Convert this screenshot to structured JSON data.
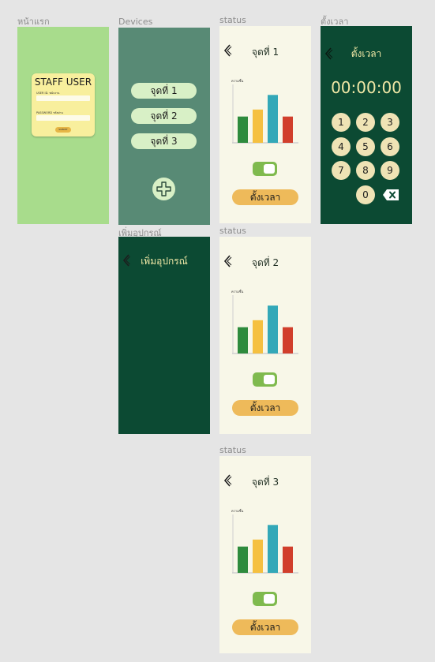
{
  "frame_labels": {
    "login": "หน้าแรก",
    "devices": "Devices",
    "add_device": "เพิ่มอุปกรณ์",
    "timer": "ตั้งเวลา",
    "status": "status"
  },
  "login": {
    "title": "STAFF USER",
    "user_label": "USER ID. พนักงาน",
    "password_label": "PASSWORD รหัสผ่าน",
    "submit_label": "SUBMIT"
  },
  "devices": {
    "items": [
      "จุดที่ 1",
      "จุดที่ 2",
      "จุดที่ 3"
    ],
    "add_icon": "plus-icon"
  },
  "add_device": {
    "title": "เพิ่มอุปกรณ์"
  },
  "status_screens": [
    {
      "title": "จุดที่ 1",
      "chart_label": "ความชื้น",
      "toggle_on": true,
      "button_label": "ตั้งเวลา"
    },
    {
      "title": "จุดที่ 2",
      "chart_label": "ความชื้น",
      "toggle_on": true,
      "button_label": "ตั้งเวลา"
    },
    {
      "title": "จุดที่ 3",
      "chart_label": "ความชื้น",
      "toggle_on": true,
      "button_label": "ตั้งเวลา"
    }
  ],
  "chart_data": {
    "type": "bar",
    "ylabel": "ความชื้น",
    "values": [
      45,
      57,
      82,
      45
    ],
    "ylim": [
      0,
      100
    ],
    "colors": [
      "#2e8b3d",
      "#f5c040",
      "#33a8b8",
      "#d13f2c"
    ]
  },
  "timer": {
    "title": "ตั้งเวลา",
    "display": "00:00:00",
    "keys": [
      "1",
      "2",
      "3",
      "4",
      "5",
      "6",
      "7",
      "8",
      "9",
      "0"
    ],
    "backspace_icon": "backspace-icon"
  },
  "colors": {
    "canvas": "#e5e5e5",
    "login_bg": "#a8dc8c",
    "devices_bg": "#588a75",
    "dark_green": "#0c4a33",
    "status_bg": "#f8f7e8",
    "accent_yellow": "#eeba5a",
    "toggle_green": "#7fba4e"
  }
}
